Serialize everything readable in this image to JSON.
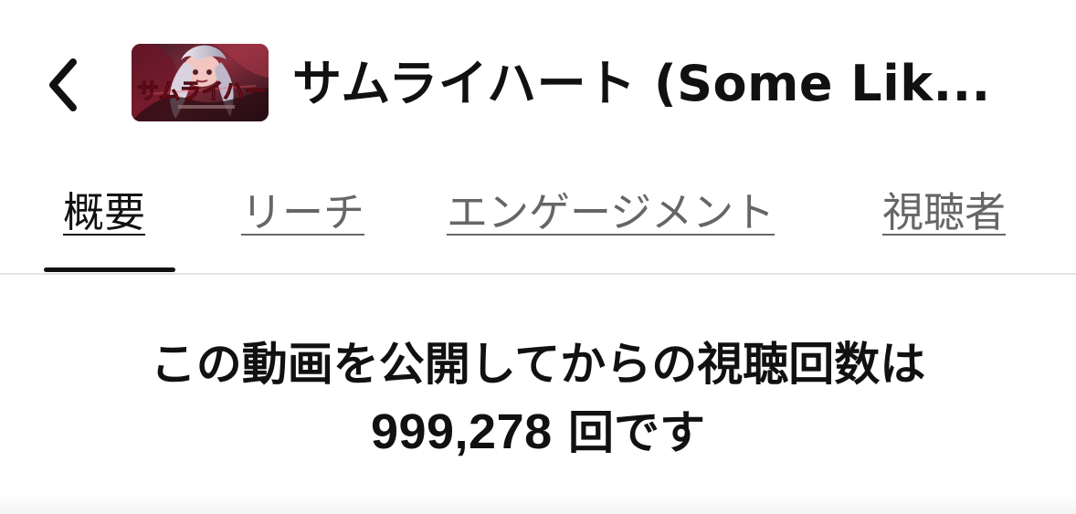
{
  "header": {
    "back_icon": "chevron-left-icon",
    "thumbnail_logo_text": "サムライハート",
    "title": "サムライハート (Some Lik..."
  },
  "tabs": [
    {
      "label": "概要",
      "active": true
    },
    {
      "label": "リーチ",
      "active": false
    },
    {
      "label": "エンゲージメント",
      "active": false
    },
    {
      "label": "視聴者",
      "active": false
    }
  ],
  "summary": {
    "line1": "この動画を公開してからの視聴回数は",
    "views": "999,278",
    "line2_suffix": " 回です"
  },
  "colors": {
    "background": "#ffffff",
    "text": "#111111",
    "inactive_tab": "#666666",
    "divider": "#e2e2e2"
  }
}
